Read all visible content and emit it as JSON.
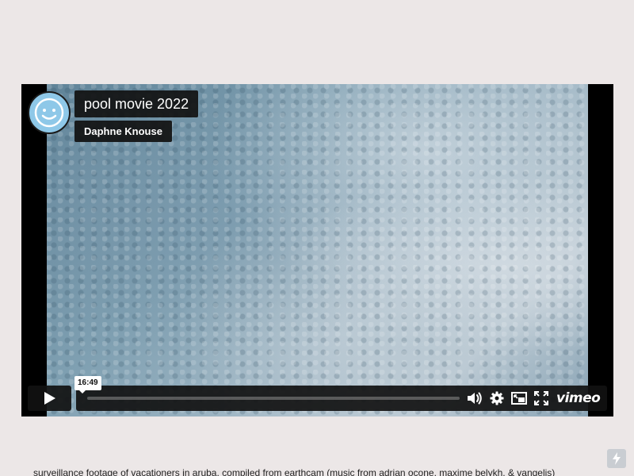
{
  "video": {
    "title": "pool movie 2022",
    "author": "Daphne Knouse",
    "hover_time": "16:49",
    "brand": "vimeo"
  },
  "controls": {
    "play_icon": "play-icon",
    "volume_icon": "volume-icon",
    "settings_icon": "gear-icon",
    "pip_icon": "picture-in-picture-icon",
    "fullscreen_icon": "fullscreen-icon"
  },
  "description": "surveillance footage of vacationers in aruba, compiled from earthcam (music from adrian ocone, maxime belykh, & vangelis)",
  "colors": {
    "page_background": "#ece7e7",
    "control_background": "#111111",
    "avatar_blue": "#8ec8e8"
  }
}
